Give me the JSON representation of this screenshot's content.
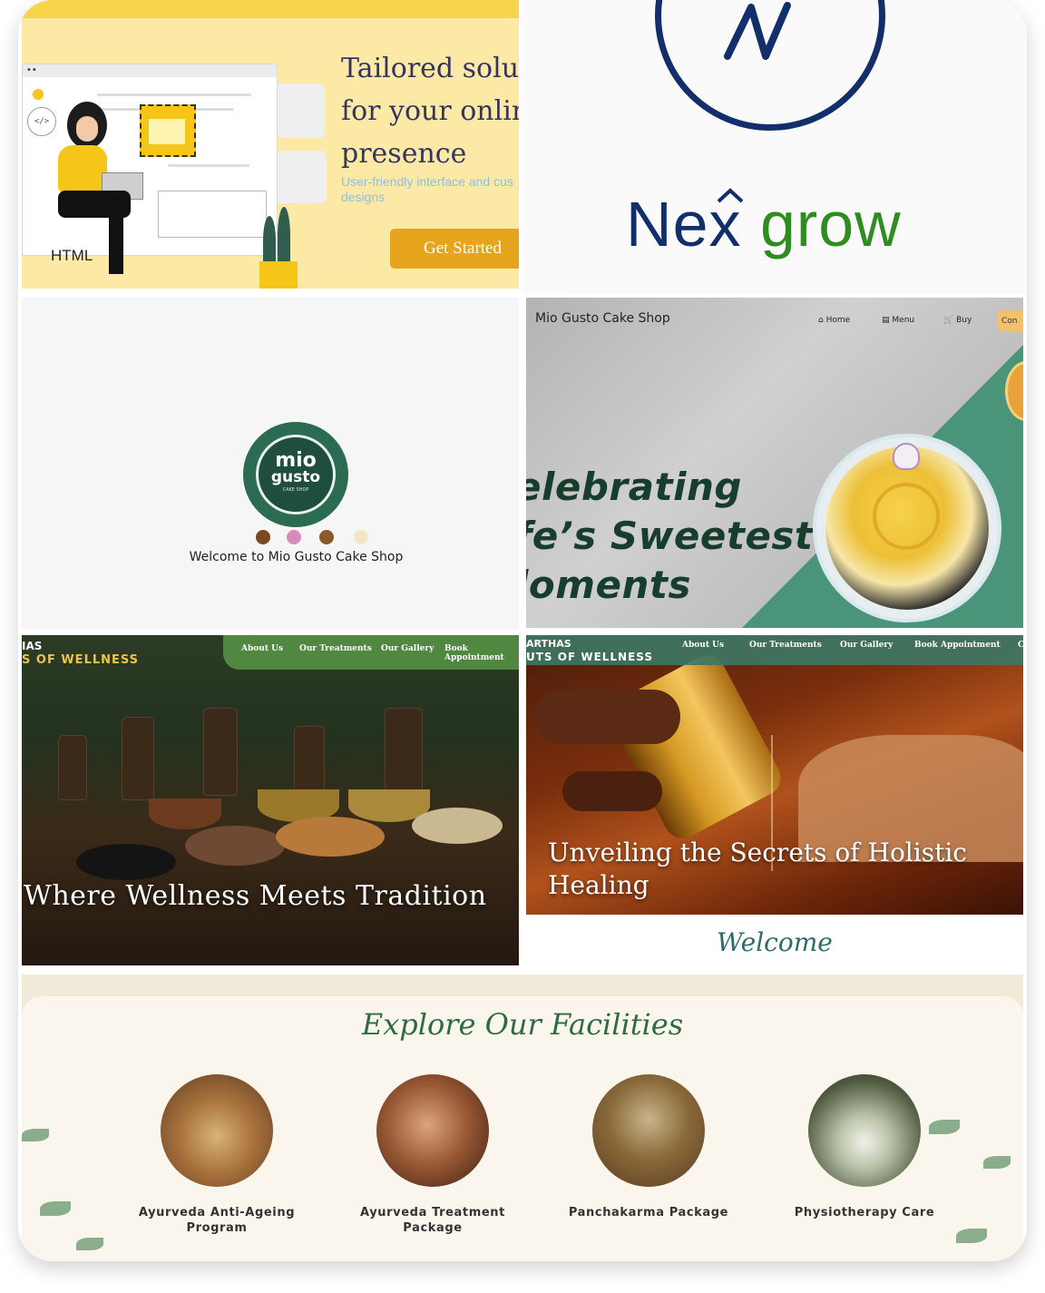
{
  "tile_tailored": {
    "headline": "Tailored solut\nfor your onlin\npresence",
    "subtext": "User-friendly interface and cus designs",
    "cta_label": "Get Started",
    "illustration_label": "HTML",
    "code_badge": "</>"
  },
  "tile_nexgrow": {
    "wordmark_n": "N",
    "wordmark_ex": "ex",
    "wordmark_grow": "grow",
    "colors": {
      "navy": "#122f6b",
      "green": "#2f8d1f"
    }
  },
  "tile_miogusto_intro": {
    "logo_line1": "mio",
    "logo_line2": "gusto",
    "logo_line3": "CAKE SHOP",
    "welcome_text": "Welcome to Mio Gusto Cake Shop"
  },
  "tile_miogusto_hero": {
    "shop_name": "Mio Gusto Cake Shop",
    "nav": [
      "Home",
      "Menu",
      "Buy"
    ],
    "nav_icons": [
      "home-icon",
      "menu-icon",
      "cart-icon"
    ],
    "contact_label": "Con",
    "headline": "elebrating\nfe’s Sweetest\nloments",
    "colors": {
      "accent": "#4a9479",
      "headline": "#173d2f",
      "contact": "#f3c16a"
    }
  },
  "tile_wellness_tradition": {
    "brand_line1": "IAS",
    "brand_line2": "S OF WELLNESS",
    "nav": [
      "About Us",
      "Our Treatments",
      "Our Gallery",
      "Book Appointment"
    ],
    "headline": "Where Wellness Meets Tradition"
  },
  "tile_holistic": {
    "brand_line1": "ARTHAS",
    "brand_line2": "UTS OF WELLNESS",
    "nav": [
      "About Us",
      "Our Treatments",
      "Our Gallery",
      "Book Appointment",
      "C"
    ],
    "headline": "Unveiling the Secrets of Holistic Healing"
  },
  "welcome_heading": "Welcome",
  "facilities": {
    "title": "Explore Our Facilities",
    "items": [
      {
        "label": "Ayurveda Anti-Ageing Program",
        "image": "herbal-bowl-image"
      },
      {
        "label": "Ayurveda Treatment Package",
        "image": "massage-image"
      },
      {
        "label": "Panchakarma Package",
        "image": "herb-pot-image"
      },
      {
        "label": "Physiotherapy Care",
        "image": "mortar-pestle-image"
      }
    ]
  }
}
